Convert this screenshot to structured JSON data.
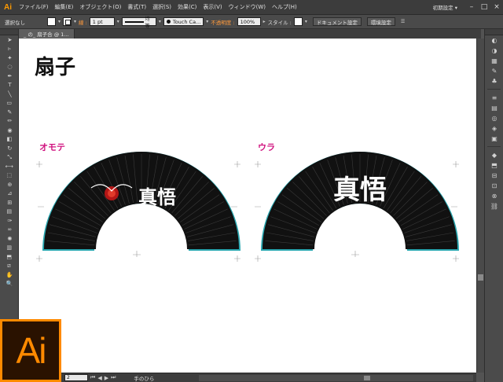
{
  "menubar": {
    "app_logo": "Ai",
    "items": [
      "ファイル(F)",
      "編集(E)",
      "オブジェクト(O)",
      "書式(T)",
      "選択(S)",
      "効果(C)",
      "表示(V)",
      "ウィンドウ(W)",
      "ヘルプ(H)"
    ],
    "workspace": "初期設定 ▾",
    "window_buttons": [
      "–",
      "□",
      "×"
    ]
  },
  "controlbar": {
    "selection": "選択なし",
    "stroke_label": "線 :",
    "stroke_weight": "1 pt",
    "stroke_style_label": "均等",
    "brush": "Touch Ca...",
    "opacity_label": "不透明度 :",
    "opacity_value": "100%",
    "style_label": "スタイル :",
    "document_setup_button": "ドキュメント設定",
    "preferences_button": "環境設定",
    "colors": {
      "accent": "#ff9a3c",
      "fill": "#ffffff"
    }
  },
  "tab": {
    "title": "_ の_ 扇子合 @ 1..."
  },
  "artboard": {
    "title": "扇子",
    "front_label": "オモテ",
    "back_label": "ウラ",
    "colors": {
      "label": "#d0127f",
      "fan": "#111111",
      "bleed": "#2aa7b0"
    }
  },
  "statusbar": {
    "zoom": "2",
    "artboard_name": "手のひら"
  },
  "tools": [
    "selection-icon",
    "direct-selection-icon",
    "magic-wand-icon",
    "lasso-icon",
    "pen-icon",
    "type-icon",
    "line-icon",
    "rectangle-icon",
    "paintbrush-icon",
    "pencil-icon",
    "blob-brush-icon",
    "eraser-icon",
    "rotate-icon",
    "scale-icon",
    "width-icon",
    "free-transform-icon",
    "shape-builder-icon",
    "perspective-icon",
    "mesh-icon",
    "gradient-icon",
    "eyedropper-icon",
    "blend-icon",
    "symbol-sprayer-icon",
    "column-graph-icon",
    "artboard-icon",
    "slice-icon",
    "hand-icon",
    "zoom-icon"
  ],
  "dock_icons": [
    "color-icon",
    "color-guide-icon",
    "swatches-icon",
    "brushes-icon",
    "symbols-icon",
    "stroke-icon",
    "gradient-panel-icon",
    "transparency-icon",
    "appearance-icon",
    "graphic-styles-icon",
    "layers-icon",
    "artboards-icon",
    "align-icon",
    "transform-icon",
    "pathfinder-icon",
    "links-icon"
  ]
}
